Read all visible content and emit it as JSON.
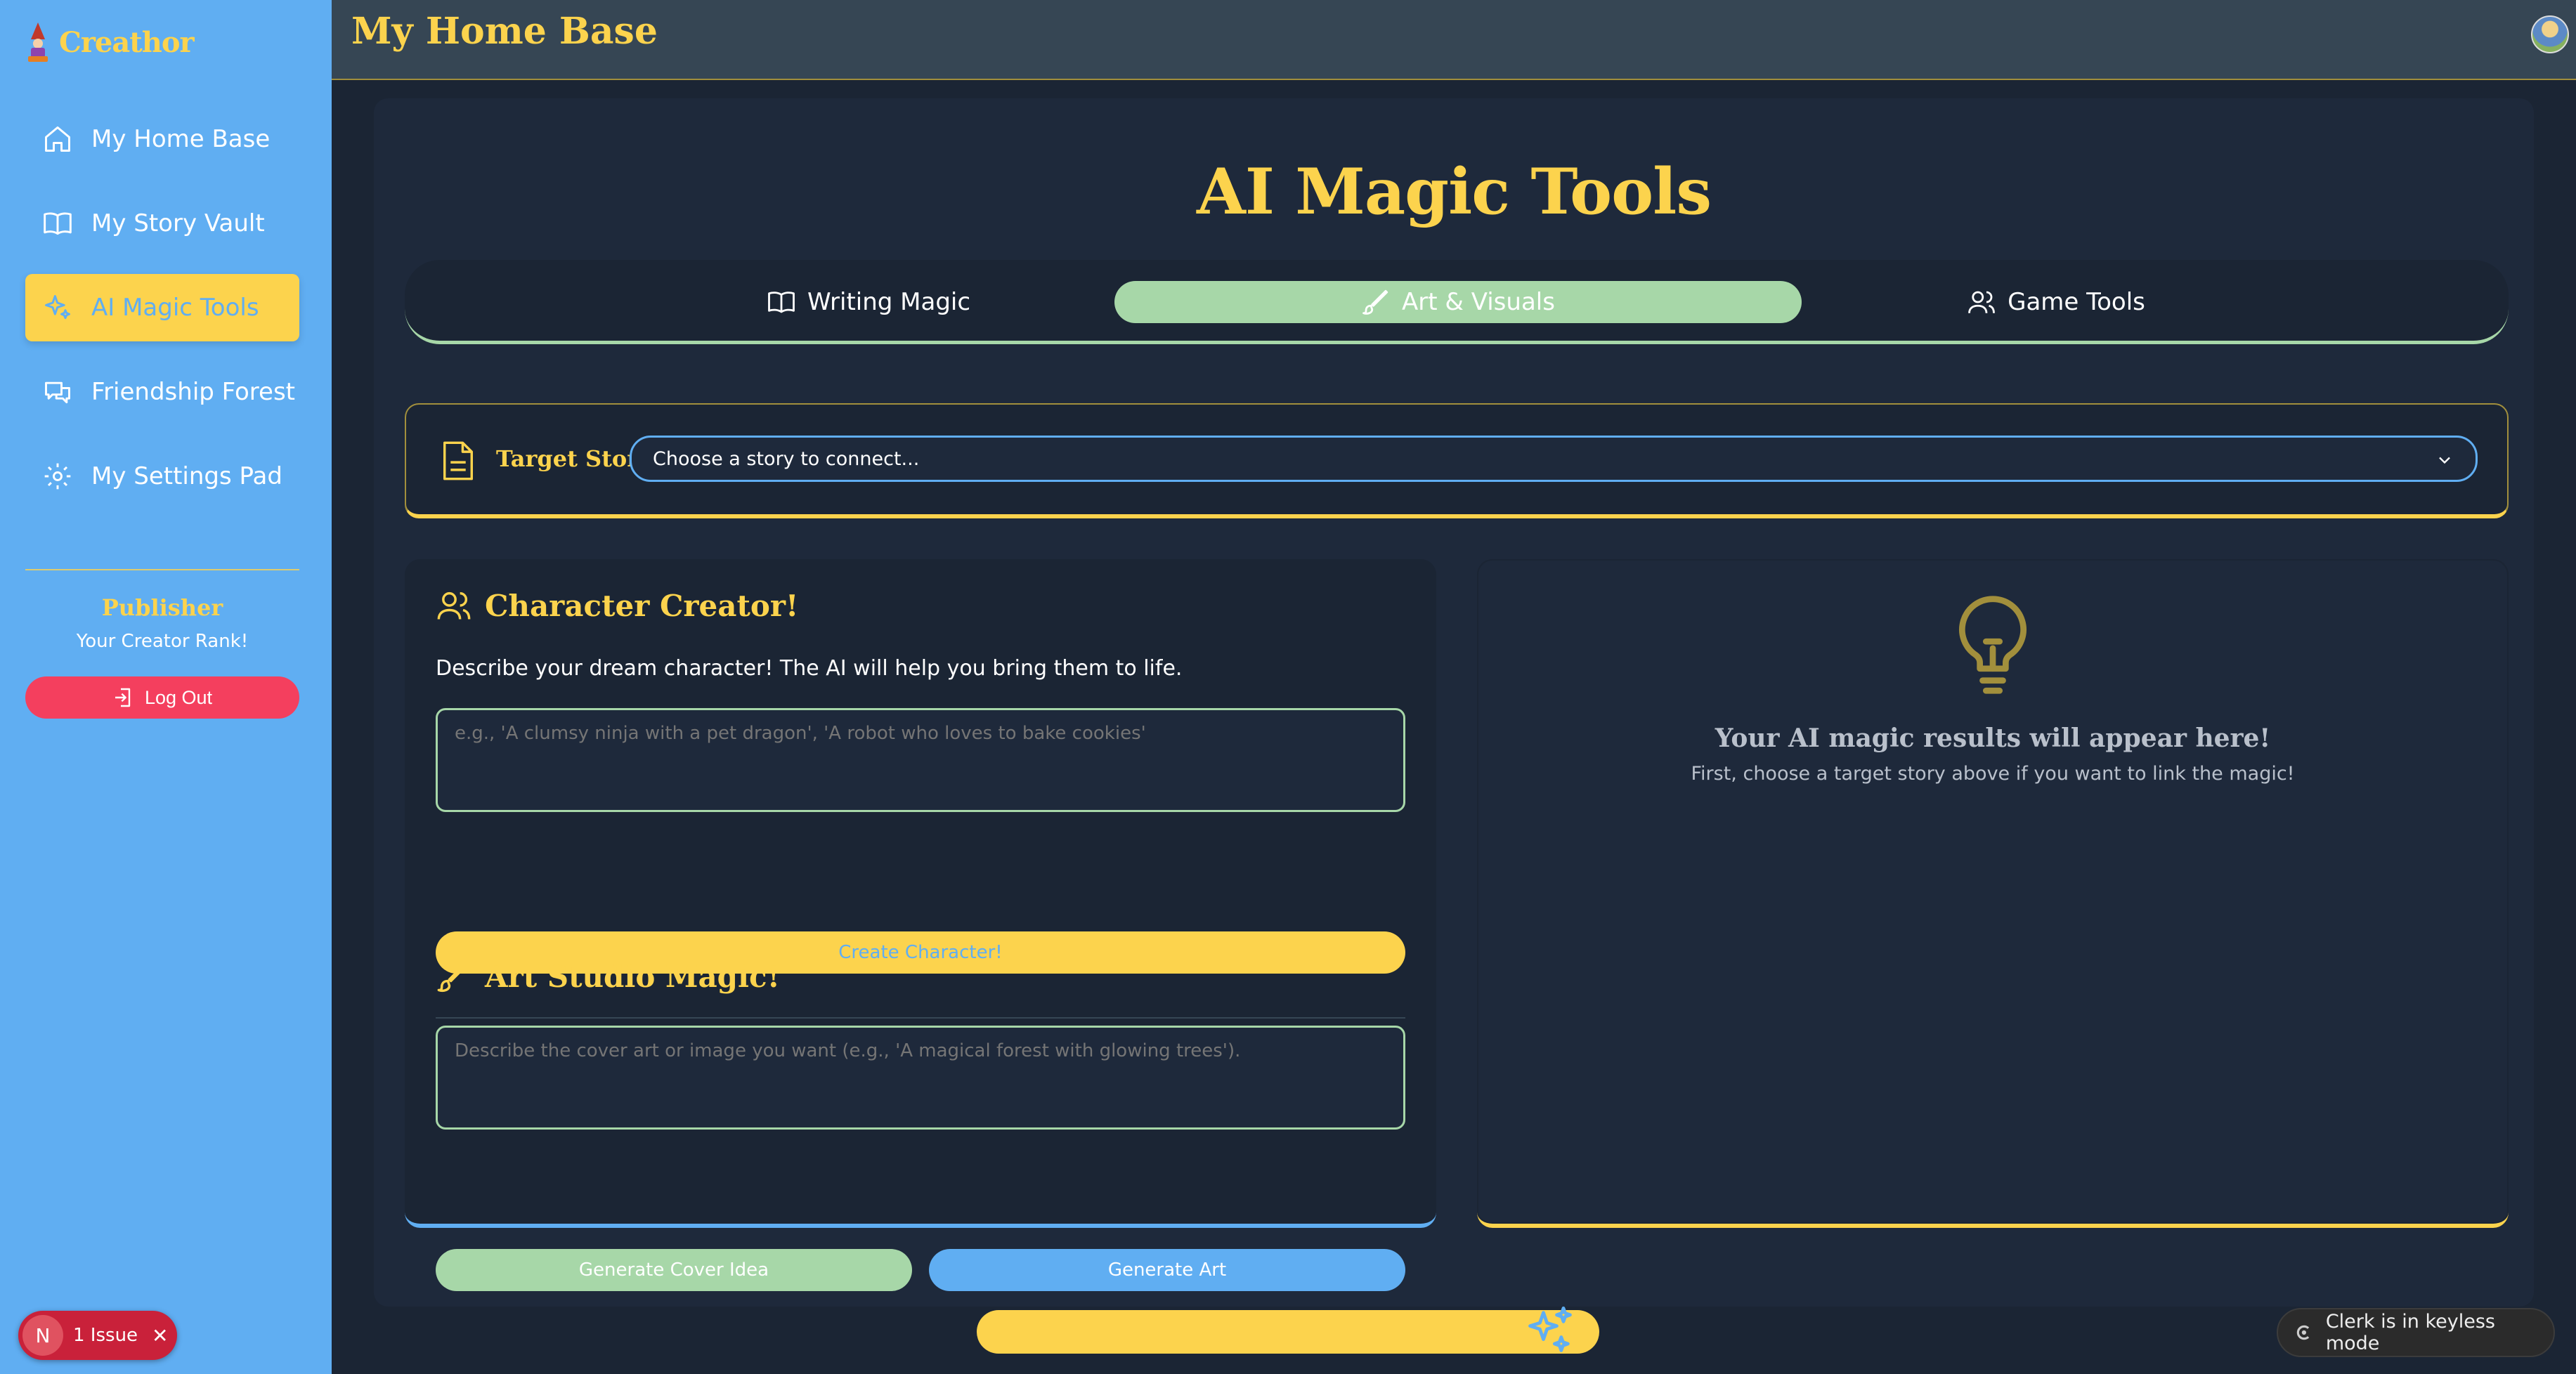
{
  "app": {
    "brand": "Creathor"
  },
  "sidebar": {
    "items": [
      {
        "label": "My Home Base",
        "icon": "home-icon"
      },
      {
        "label": "My Story Vault",
        "icon": "book-icon"
      },
      {
        "label": "AI Magic Tools",
        "icon": "sparkles-icon",
        "active": true
      },
      {
        "label": "Friendship Forest",
        "icon": "chat-bubbles-icon"
      },
      {
        "label": "My Settings Pad",
        "icon": "gear-icon"
      }
    ],
    "rank_title": "Publisher",
    "rank_subtitle": "Your Creator Rank!",
    "logout_label": "Log Out"
  },
  "header": {
    "title": "My Home Base"
  },
  "main": {
    "title": "AI Magic Tools",
    "tabs": [
      {
        "label": "Writing Magic",
        "icon": "book-icon"
      },
      {
        "label": "Art & Visuals",
        "icon": "brush-icon",
        "active": true
      },
      {
        "label": "Game Tools",
        "icon": "users-icon"
      }
    ],
    "target": {
      "label": "Target Story:",
      "select_value": "Choose a story to connect..."
    },
    "character": {
      "title": "Character Creator!",
      "description": "Describe your dream character! The AI will help you bring them to life.",
      "placeholder": "e.g., 'A clumsy ninja with a pet dragon', 'A robot who loves to bake cookies'",
      "button": "Create Character!"
    },
    "art": {
      "title": "Art Studio Magic!",
      "placeholder": "Describe the cover art or image you want (e.g., 'A magical forest with glowing trees').",
      "cover_button": "Generate Cover Idea",
      "art_button": "Generate Art"
    },
    "results": {
      "title": "Your AI magic results will appear here!",
      "subtitle": "First, choose a target story above if you want to link the magic!"
    }
  },
  "dev": {
    "issue_letter": "N",
    "issue_label": "1 Issue",
    "clerk_label": "Clerk is in keyless mode"
  },
  "colors": {
    "sidebar": "#60aef2",
    "accent_yellow": "#fcd34d",
    "accent_green": "#a7d7a8",
    "panel": "#1e293b",
    "danger": "#f43f5e"
  }
}
